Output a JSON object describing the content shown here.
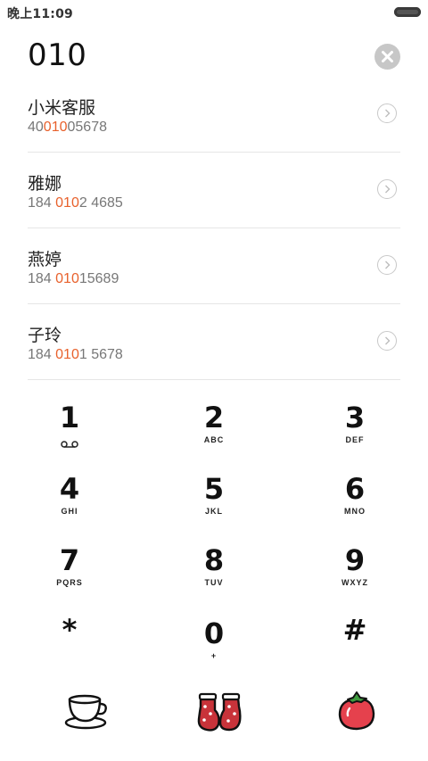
{
  "status_bar": {
    "time": "晚上11:09",
    "battery_icon": "battery-icon"
  },
  "dialer": {
    "entry_value": "010",
    "clear_icon": "clear-icon"
  },
  "contacts": [
    {
      "name": "小米客服",
      "number_parts": [
        "40",
        "010",
        "05678"
      ]
    },
    {
      "name": "雅娜",
      "number_parts": [
        "184 ",
        "010",
        "2 4685"
      ]
    },
    {
      "name": "燕婷",
      "number_parts": [
        "184 ",
        "010",
        "15689"
      ]
    },
    {
      "name": "子玲",
      "number_parts": [
        "184 ",
        "010",
        "1 5678"
      ]
    }
  ],
  "keypad": [
    {
      "digit": "1",
      "letters": "",
      "symbol": "voicemail-icon"
    },
    {
      "digit": "2",
      "letters": "ABC"
    },
    {
      "digit": "3",
      "letters": "DEF"
    },
    {
      "digit": "4",
      "letters": "GHI"
    },
    {
      "digit": "5",
      "letters": "JKL"
    },
    {
      "digit": "6",
      "letters": "MNO"
    },
    {
      "digit": "7",
      "letters": "PQRS"
    },
    {
      "digit": "8",
      "letters": "TUV"
    },
    {
      "digit": "9",
      "letters": "WXYZ"
    },
    {
      "digit": "*",
      "letters": ""
    },
    {
      "digit": "0",
      "letters": "+"
    },
    {
      "digit": "#",
      "letters": ""
    }
  ],
  "actions": {
    "left_icon": "teacup-icon",
    "center_icon": "mittens-icon",
    "right_icon": "tomato-icon"
  },
  "colors": {
    "highlight": "#e8612c",
    "divider": "#e6e6e6",
    "clear_button": "#c7c7c7",
    "secondary_text": "#777777"
  }
}
